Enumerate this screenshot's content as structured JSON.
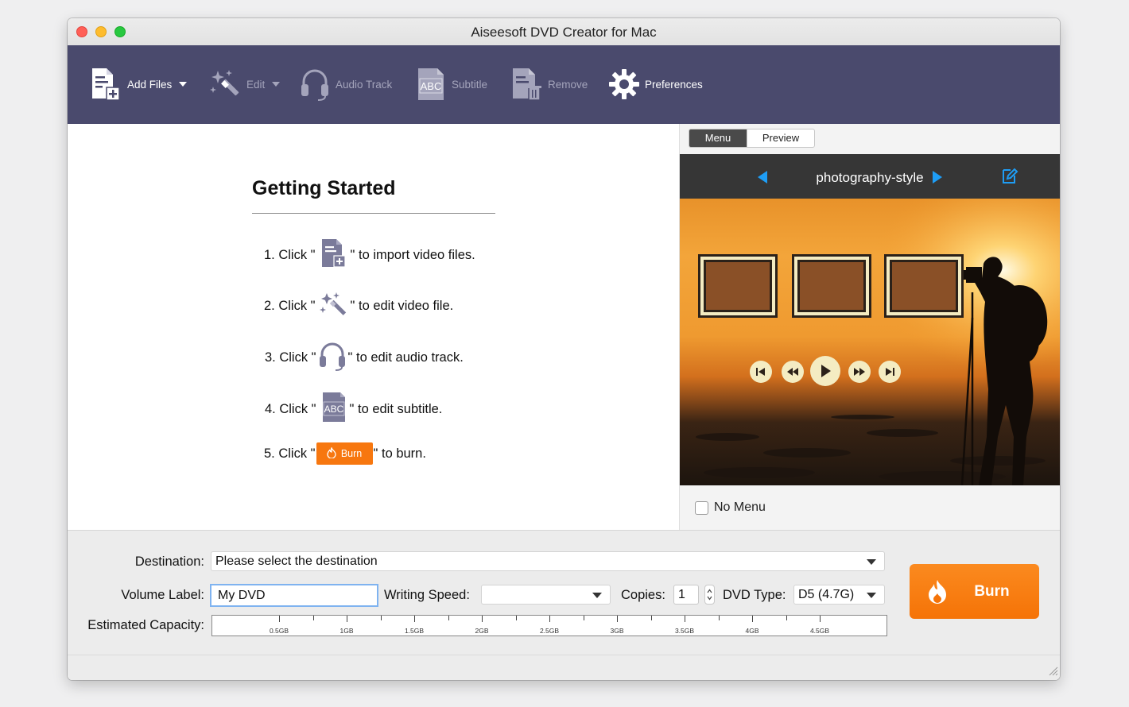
{
  "window": {
    "title": "Aiseesoft DVD Creator for Mac"
  },
  "toolbar": {
    "add_files": "Add Files",
    "edit": "Edit",
    "audio_track": "Audio Track",
    "subtitle": "Subtitle",
    "remove": "Remove",
    "preferences": "Preferences"
  },
  "getting_started": {
    "title": "Getting Started",
    "steps": [
      {
        "prefix": "1. Click \"",
        "suffix": "\" to import video files.",
        "icon": "add-file-icon"
      },
      {
        "prefix": "2. Click \"",
        "suffix": "\" to edit video file.",
        "icon": "magic-wand-icon"
      },
      {
        "prefix": "3. Click \"",
        "suffix": "\" to edit audio track.",
        "icon": "headphones-icon"
      },
      {
        "prefix": "4. Click \"",
        "suffix": "\" to edit subtitle.",
        "icon": "abc-subtitle-icon"
      },
      {
        "prefix": "5. Click \"",
        "suffix": "\" to burn.",
        "icon": "flame-icon",
        "button_label": "Burn"
      }
    ]
  },
  "menu_panel": {
    "tabs": [
      "Menu",
      "Preview"
    ],
    "active_tab": "Menu",
    "template_name": "photography-style",
    "no_menu_label": "No Menu",
    "no_menu_checked": false
  },
  "bottom": {
    "destination_label": "Destination:",
    "destination_value": "Please select the destination",
    "volume_label_label": "Volume Label:",
    "volume_label_value": "My DVD",
    "writing_speed_label": "Writing Speed:",
    "writing_speed_value": "",
    "copies_label": "Copies:",
    "copies_value": "1",
    "dvd_type_label": "DVD Type:",
    "dvd_type_value": "D5 (4.7G)",
    "capacity_label": "Estimated Capacity:",
    "capacity_ticks": [
      "0.5GB",
      "1GB",
      "1.5GB",
      "2GB",
      "2.5GB",
      "3GB",
      "3.5GB",
      "4GB",
      "4.5GB"
    ],
    "burn_label": "Burn"
  },
  "colors": {
    "toolbar_bg": "#4a4a6d",
    "accent_blue": "#1e9df5",
    "burn_orange": "#f7770f"
  }
}
